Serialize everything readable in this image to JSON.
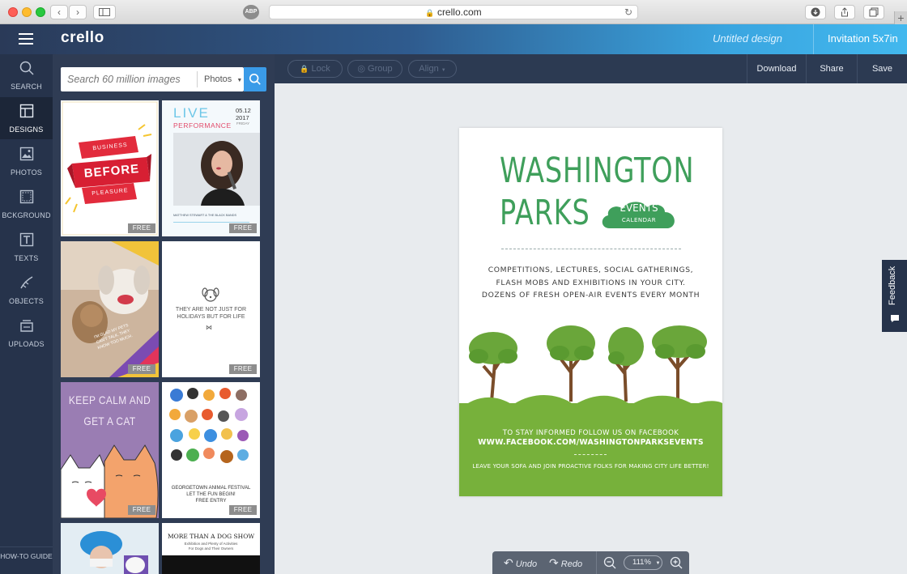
{
  "browser": {
    "url": "crello.com",
    "abp_label": "ABP"
  },
  "app": {
    "logo": "crello",
    "doc_title": "Untitled design",
    "doc_format": "Invitation 5x7in"
  },
  "sidebar": {
    "items": [
      {
        "label": "SEARCH",
        "icon": "search-icon"
      },
      {
        "label": "DESIGNS",
        "icon": "designs-icon",
        "active": true
      },
      {
        "label": "PHOTOS",
        "icon": "photos-icon"
      },
      {
        "label": "BCKGROUND",
        "icon": "background-icon"
      },
      {
        "label": "TEXTS",
        "icon": "texts-icon"
      },
      {
        "label": "OBJECTS",
        "icon": "objects-icon"
      },
      {
        "label": "UPLOADS",
        "icon": "uploads-icon"
      }
    ],
    "howto": "HOW-TO GUIDE"
  },
  "search": {
    "placeholder": "Search 60 million images",
    "filter": "Photos"
  },
  "templates": {
    "free_label": "FREE",
    "t1": {
      "line1": "BUSINESS",
      "line2": "BEFORE",
      "line3": "PLEASURE"
    },
    "t2": {
      "line1": "LIVE",
      "line2": "PERFORMANCE",
      "date": "05.12",
      "year": "2017",
      "day": "FRIDAY",
      "footer": "MATTHEW STEWART & THE BLACK BANDS"
    },
    "t3": {
      "caption": "I'M GLAD MY PETS CAN'T TALK. THEY KNOW TOO MUCH."
    },
    "t4": {
      "text": "THEY ARE NOT JUST FOR HOLIDAYS BUT FOR LIFE"
    },
    "t5": {
      "line1": "KEEP CALM AND",
      "line2": "GET A CAT"
    },
    "t6": {
      "line1": "GEORGETOWN ANIMAL FESTIVAL",
      "line2": "LET THE FUN BEGIN!",
      "line3": "FREE ENTRY"
    },
    "t8": {
      "title": "MORE THAN A DOG SHOW",
      "sub1": "Exhibition and Plenty of Activities",
      "sub2": "For Dogs and Their Owners"
    }
  },
  "toolbar": {
    "lock": "Lock",
    "group": "Group",
    "align": "Align",
    "download": "Download",
    "share": "Share",
    "save": "Save"
  },
  "design": {
    "title_line1": "WASHINGTON",
    "title_line2": "PARKS",
    "badge_line1": "EVENTS",
    "badge_line2": "CALENDAR",
    "body": [
      "COMPETITIONS, LECTURES, SOCIAL GATHERINGS,",
      "FLASH MOBS AND EXHIBITIONS IN YOUR CITY.",
      "DOZENS OF FRESH OPEN-AIR EVENTS EVERY MONTH"
    ],
    "follow": "TO STAY INFORMED FOLLOW US ON FACEBOOK",
    "url": "WWW.FACEBOOK.COM/WASHINGTONPARKSEVENTS",
    "tagline": "LEAVE YOUR SOFA AND JOIN PROACTIVE FOLKS FOR MAKING CITY LIFE BETTER!"
  },
  "feedback": {
    "label": "Feedback"
  },
  "bottom": {
    "undo": "Undo",
    "redo": "Redo",
    "zoom": "111%"
  },
  "colors": {
    "accent_blue": "#3a9be8",
    "sidebar": "#26334b",
    "design_green": "#3f9f5b",
    "grass_green": "#77b13b"
  }
}
